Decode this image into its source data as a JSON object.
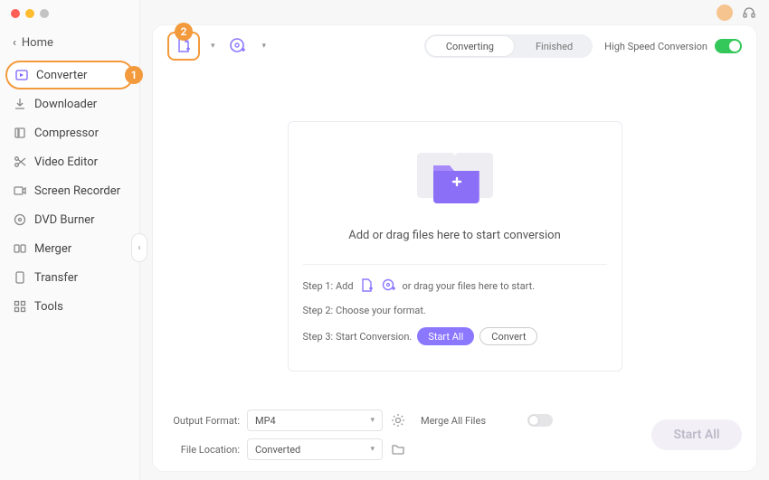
{
  "home_label": "Home",
  "sidebar": {
    "items": [
      {
        "label": "Converter",
        "icon": "converter"
      },
      {
        "label": "Downloader",
        "icon": "downloader"
      },
      {
        "label": "Compressor",
        "icon": "compressor"
      },
      {
        "label": "Video Editor",
        "icon": "editor"
      },
      {
        "label": "Screen Recorder",
        "icon": "recorder"
      },
      {
        "label": "DVD Burner",
        "icon": "dvd"
      },
      {
        "label": "Merger",
        "icon": "merger"
      },
      {
        "label": "Transfer",
        "icon": "transfer"
      },
      {
        "label": "Tools",
        "icon": "tools"
      }
    ]
  },
  "callouts": {
    "one": "1",
    "two": "2"
  },
  "tabs": {
    "converting": "Converting",
    "finished": "Finished"
  },
  "high_speed_label": "High Speed Conversion",
  "dropzone": {
    "message": "Add or drag files here to start conversion",
    "step1_prefix": "Step 1: Add",
    "step1_suffix": "or drag your files here to start.",
    "step2": "Step 2: Choose your format.",
    "step3": "Step 3: Start Conversion.",
    "start_all_btn": "Start  All",
    "convert_btn": "Convert"
  },
  "bottom": {
    "output_format_label": "Output Format:",
    "output_format_value": "MP4",
    "file_location_label": "File Location:",
    "file_location_value": "Converted",
    "merge_label": "Merge All Files",
    "start_all": "Start All"
  }
}
